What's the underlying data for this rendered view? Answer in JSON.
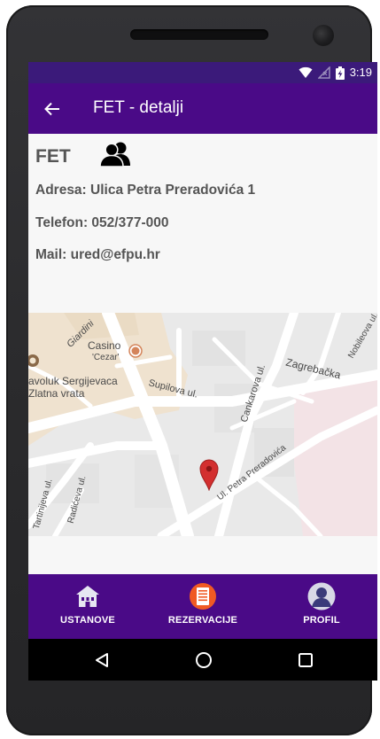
{
  "status_bar": {
    "time": "3:19",
    "icons": [
      "wifi-icon",
      "no-signal-icon",
      "battery-charging-icon"
    ]
  },
  "app_bar": {
    "back_icon": "arrow-left-icon",
    "title": "FET - detalji"
  },
  "details": {
    "name": "FET",
    "name_icon": "group-icon",
    "address": "Adresa: Ulica Petra Preradovića 1",
    "phone": "Telefon: 052/377-000",
    "mail": "Mail: ured@efpu.hr"
  },
  "map": {
    "labels": {
      "giardini": "Giardini",
      "casino_1": "Casino",
      "casino_2": "'Cezar'",
      "sergijevaca_1": "avoluk Sergijevaca",
      "sergijevaca_2": "Zlatna vrata",
      "supilova": "Supilova ul.",
      "cankarova": "Cankarova ul.",
      "zagrebacka": "Zagrebačka",
      "nobileova": "Nobileova ul.",
      "preradovica": "Ul. Petra Preradovića",
      "tartinijeva": "Tartinijeva ul.",
      "radiceva": "Radićeva ul."
    },
    "marker_color": "#d32f2f"
  },
  "bottom_nav": {
    "items": [
      {
        "label": "USTANOVE",
        "icon": "institution-icon"
      },
      {
        "label": "REZERVACIJE",
        "icon": "reservations-icon"
      },
      {
        "label": "PROFIL",
        "icon": "profile-icon"
      }
    ]
  },
  "android_nav": {
    "back_icon": "triangle-back-icon",
    "home_icon": "circle-home-icon",
    "recents_icon": "square-recents-icon"
  },
  "colors": {
    "status_bar": "#3b1a7a",
    "primary": "#4a0a87",
    "text": "#555555"
  }
}
